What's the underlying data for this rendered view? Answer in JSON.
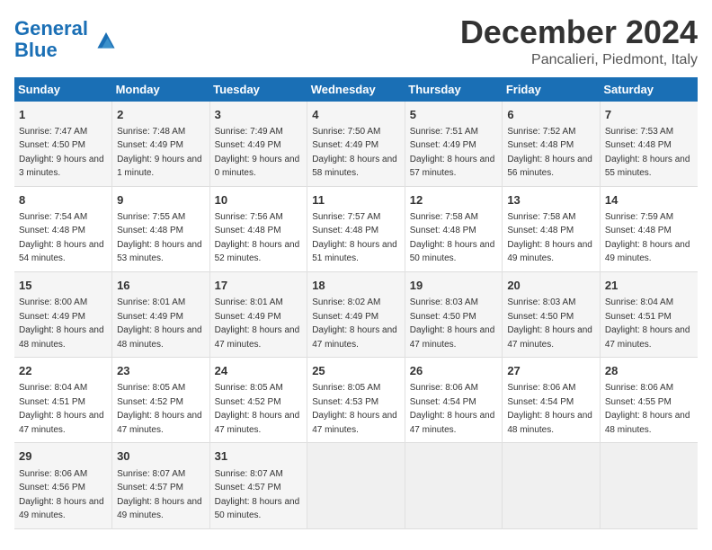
{
  "logo": {
    "text_general": "General",
    "text_blue": "Blue"
  },
  "header": {
    "month": "December 2024",
    "location": "Pancalieri, Piedmont, Italy"
  },
  "weekdays": [
    "Sunday",
    "Monday",
    "Tuesday",
    "Wednesday",
    "Thursday",
    "Friday",
    "Saturday"
  ],
  "weeks": [
    [
      {
        "day": "1",
        "sunrise": "7:47 AM",
        "sunset": "4:50 PM",
        "daylight": "9 hours and 3 minutes."
      },
      {
        "day": "2",
        "sunrise": "7:48 AM",
        "sunset": "4:49 PM",
        "daylight": "9 hours and 1 minute."
      },
      {
        "day": "3",
        "sunrise": "7:49 AM",
        "sunset": "4:49 PM",
        "daylight": "9 hours and 0 minutes."
      },
      {
        "day": "4",
        "sunrise": "7:50 AM",
        "sunset": "4:49 PM",
        "daylight": "8 hours and 58 minutes."
      },
      {
        "day": "5",
        "sunrise": "7:51 AM",
        "sunset": "4:49 PM",
        "daylight": "8 hours and 57 minutes."
      },
      {
        "day": "6",
        "sunrise": "7:52 AM",
        "sunset": "4:48 PM",
        "daylight": "8 hours and 56 minutes."
      },
      {
        "day": "7",
        "sunrise": "7:53 AM",
        "sunset": "4:48 PM",
        "daylight": "8 hours and 55 minutes."
      }
    ],
    [
      {
        "day": "8",
        "sunrise": "7:54 AM",
        "sunset": "4:48 PM",
        "daylight": "8 hours and 54 minutes."
      },
      {
        "day": "9",
        "sunrise": "7:55 AM",
        "sunset": "4:48 PM",
        "daylight": "8 hours and 53 minutes."
      },
      {
        "day": "10",
        "sunrise": "7:56 AM",
        "sunset": "4:48 PM",
        "daylight": "8 hours and 52 minutes."
      },
      {
        "day": "11",
        "sunrise": "7:57 AM",
        "sunset": "4:48 PM",
        "daylight": "8 hours and 51 minutes."
      },
      {
        "day": "12",
        "sunrise": "7:58 AM",
        "sunset": "4:48 PM",
        "daylight": "8 hours and 50 minutes."
      },
      {
        "day": "13",
        "sunrise": "7:58 AM",
        "sunset": "4:48 PM",
        "daylight": "8 hours and 49 minutes."
      },
      {
        "day": "14",
        "sunrise": "7:59 AM",
        "sunset": "4:48 PM",
        "daylight": "8 hours and 49 minutes."
      }
    ],
    [
      {
        "day": "15",
        "sunrise": "8:00 AM",
        "sunset": "4:49 PM",
        "daylight": "8 hours and 48 minutes."
      },
      {
        "day": "16",
        "sunrise": "8:01 AM",
        "sunset": "4:49 PM",
        "daylight": "8 hours and 48 minutes."
      },
      {
        "day": "17",
        "sunrise": "8:01 AM",
        "sunset": "4:49 PM",
        "daylight": "8 hours and 47 minutes."
      },
      {
        "day": "18",
        "sunrise": "8:02 AM",
        "sunset": "4:49 PM",
        "daylight": "8 hours and 47 minutes."
      },
      {
        "day": "19",
        "sunrise": "8:03 AM",
        "sunset": "4:50 PM",
        "daylight": "8 hours and 47 minutes."
      },
      {
        "day": "20",
        "sunrise": "8:03 AM",
        "sunset": "4:50 PM",
        "daylight": "8 hours and 47 minutes."
      },
      {
        "day": "21",
        "sunrise": "8:04 AM",
        "sunset": "4:51 PM",
        "daylight": "8 hours and 47 minutes."
      }
    ],
    [
      {
        "day": "22",
        "sunrise": "8:04 AM",
        "sunset": "4:51 PM",
        "daylight": "8 hours and 47 minutes."
      },
      {
        "day": "23",
        "sunrise": "8:05 AM",
        "sunset": "4:52 PM",
        "daylight": "8 hours and 47 minutes."
      },
      {
        "day": "24",
        "sunrise": "8:05 AM",
        "sunset": "4:52 PM",
        "daylight": "8 hours and 47 minutes."
      },
      {
        "day": "25",
        "sunrise": "8:05 AM",
        "sunset": "4:53 PM",
        "daylight": "8 hours and 47 minutes."
      },
      {
        "day": "26",
        "sunrise": "8:06 AM",
        "sunset": "4:54 PM",
        "daylight": "8 hours and 47 minutes."
      },
      {
        "day": "27",
        "sunrise": "8:06 AM",
        "sunset": "4:54 PM",
        "daylight": "8 hours and 48 minutes."
      },
      {
        "day": "28",
        "sunrise": "8:06 AM",
        "sunset": "4:55 PM",
        "daylight": "8 hours and 48 minutes."
      }
    ],
    [
      {
        "day": "29",
        "sunrise": "8:06 AM",
        "sunset": "4:56 PM",
        "daylight": "8 hours and 49 minutes."
      },
      {
        "day": "30",
        "sunrise": "8:07 AM",
        "sunset": "4:57 PM",
        "daylight": "8 hours and 49 minutes."
      },
      {
        "day": "31",
        "sunrise": "8:07 AM",
        "sunset": "4:57 PM",
        "daylight": "8 hours and 50 minutes."
      },
      null,
      null,
      null,
      null
    ]
  ],
  "labels": {
    "sunrise": "Sunrise:",
    "sunset": "Sunset:",
    "daylight": "Daylight:"
  }
}
